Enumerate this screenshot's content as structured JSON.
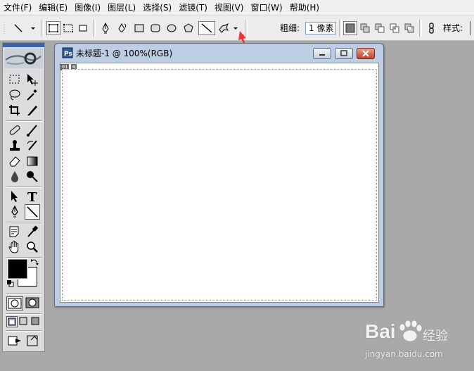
{
  "menu": [
    "文件(F)",
    "编辑(E)",
    "图像(I)",
    "图层(L)",
    "选择(S)",
    "滤镜(T)",
    "视图(V)",
    "窗口(W)",
    "帮助(H)"
  ],
  "options_bar": {
    "weight_label": "粗细:",
    "weight_value": "1 像素",
    "style_label": "样式:",
    "shape_tools": [
      "pen",
      "freeform-pen",
      "rectangle",
      "rounded-rectangle",
      "ellipse",
      "polygon",
      "line",
      "custom-shape"
    ],
    "selected_shape": "line"
  },
  "document": {
    "title": "未标题-1 @ 100%(RGB)",
    "ruler_tags": [
      "01",
      "⊠"
    ]
  },
  "toolbox": {
    "tools": [
      "rectangular-marquee",
      "move",
      "lasso",
      "magic-wand",
      "crop",
      "slice",
      "healing-brush",
      "brush",
      "clone-stamp",
      "history-brush",
      "eraser",
      "gradient",
      "blur",
      "dodge",
      "path-selection",
      "type",
      "pen",
      "line",
      "notes",
      "eyedropper",
      "hand",
      "zoom"
    ],
    "selected_tool": "line",
    "foreground_color": "#000000",
    "background_color": "#ffffff"
  },
  "watermark": {
    "brand": "Bai",
    "brand_tail": "经验",
    "url": "jingyan.baidu.com"
  },
  "colors": {
    "workspace": "#a9a9a9",
    "arrow": "#e8333a"
  }
}
